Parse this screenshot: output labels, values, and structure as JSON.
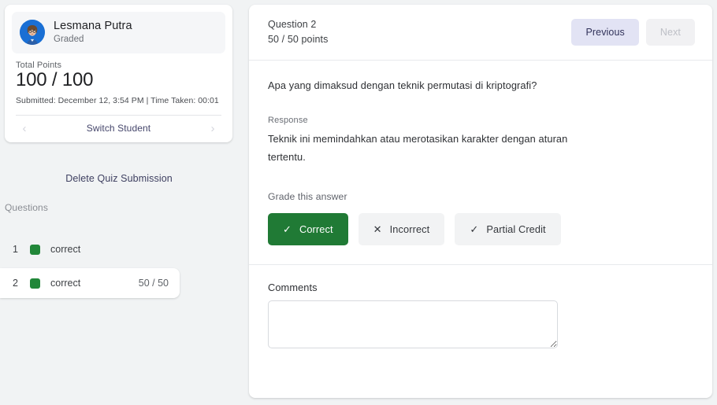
{
  "student": {
    "avatar_icon": "user-avatar-icon",
    "name": "Lesmana Putra",
    "status": "Graded",
    "total_points_label": "Total Points",
    "total_points_value": "100 / 100",
    "submitted_line": "Submitted: December 12, 3:54 PM | Time Taken: 00:01",
    "switch_label": "Switch Student",
    "prev_chevron": "‹",
    "next_chevron": "›"
  },
  "sidebar": {
    "delete_label": "Delete Quiz Submission",
    "questions_label": "Questions",
    "questions": [
      {
        "num": "1",
        "status": "correct",
        "score": "",
        "selected": false,
        "chip_color": "#218739"
      },
      {
        "num": "2",
        "status": "correct",
        "score": "50 / 50",
        "selected": true,
        "chip_color": "#218739"
      }
    ]
  },
  "panel": {
    "question_title": "Question 2",
    "question_points": "50 / 50 points",
    "previous_label": "Previous",
    "next_label": "Next",
    "question_text": "Apa yang dimaksud dengan teknik permutasi di kriptografi?",
    "response_label": "Response",
    "response_text": "Teknik ini memindahkan atau merotasikan karakter dengan aturan tertentu.",
    "grade_label": "Grade this answer",
    "grade_buttons": [
      {
        "label": "Correct",
        "icon": "check-icon",
        "glyph": "✓",
        "active": true
      },
      {
        "label": "Incorrect",
        "icon": "cross-icon",
        "glyph": "✕",
        "active": false
      },
      {
        "label": "Partial Credit",
        "icon": "check-icon",
        "glyph": "✓",
        "active": false
      }
    ],
    "comments_label": "Comments",
    "comments_value": "",
    "comments_placeholder": ""
  },
  "colors": {
    "correct_green": "#207a35",
    "chip_green": "#218739",
    "previous_btn_bg": "#e2e3f4",
    "page_bg": "#f1f3f4"
  }
}
